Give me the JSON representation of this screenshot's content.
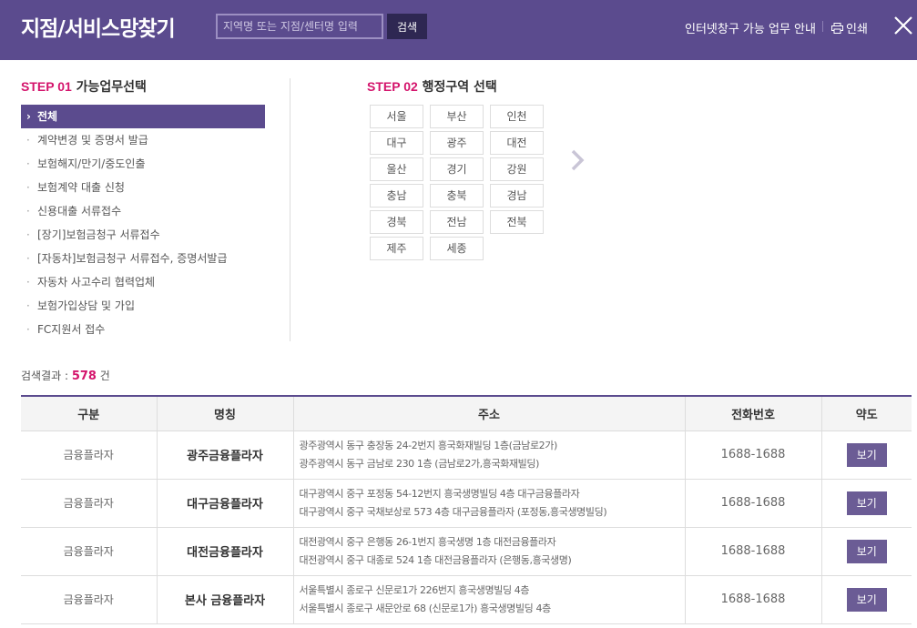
{
  "header": {
    "title": "지점/서비스망찾기",
    "search_placeholder": "지역명 또는 지점/센터명 입력",
    "search_button": "검색",
    "guide_link": "인터넷창구 가능 업무 안내",
    "print_label": "인쇄",
    "icons": {
      "print": "printer-icon",
      "close": "close-icon"
    }
  },
  "step1": {
    "step_label": "STEP 01",
    "title": "가능업무선택",
    "items": [
      {
        "mark": "›",
        "label": "전체",
        "active": true
      },
      {
        "mark": "·",
        "label": "계약변경 및 증명서 발급"
      },
      {
        "mark": "·",
        "label": "보험해지/만기/중도인출"
      },
      {
        "mark": "·",
        "label": "보험계약 대출 신청"
      },
      {
        "mark": "·",
        "label": "신용대출 서류접수"
      },
      {
        "mark": "·",
        "label": "[장기]보험금청구 서류접수"
      },
      {
        "mark": "·",
        "label": "[자동차]보험금청구 서류접수, 증명서발급"
      },
      {
        "mark": "·",
        "label": "자동차 사고수리 협력업체"
      },
      {
        "mark": "·",
        "label": "보험가입상담 및 가입"
      },
      {
        "mark": "·",
        "label": "FC지원서 접수"
      }
    ]
  },
  "step2": {
    "step_label": "STEP 02",
    "title": "행정구역 선택",
    "regions": [
      "서울",
      "부산",
      "인천",
      "대구",
      "광주",
      "대전",
      "울산",
      "경기",
      "강원",
      "충남",
      "충북",
      "경남",
      "경북",
      "전남",
      "전북",
      "제주",
      "세종"
    ],
    "next_icon": "chevron-right-icon"
  },
  "results": {
    "label": "검색결과 : ",
    "count": "578",
    "unit": " 건",
    "columns": [
      "구분",
      "명칭",
      "주소",
      "전화번호",
      "약도"
    ],
    "rows": [
      {
        "type": "금융플라자",
        "name": "광주금융플라자",
        "addr1": "광주광역시 동구 충장동 24-2번지 흥국화재빌딩 1층(금남로2가)",
        "addr2": "광주광역시 동구 금남로 230 1층 (금남로2가,흥국화재빌딩)",
        "phone": "1688-1688",
        "map": "보기"
      },
      {
        "type": "금융플라자",
        "name": "대구금융플라자",
        "addr1": "대구광역시 중구 포정동 54-12번지 흥국생명빌딩 4층 대구금융플라자",
        "addr2": "대구광역시 중구 국채보상로 573 4층 대구금융플라자 (포정동,흥국생명빌딩)",
        "phone": "1688-1688",
        "map": "보기"
      },
      {
        "type": "금융플라자",
        "name": "대전금융플라자",
        "addr1": "대전광역시 중구 은행동 26-1번지 흥국생명 1층 대전금융플라자",
        "addr2": "대전광역시 중구 대종로 524 1층 대전금융플라자 (은행동,흥국생명)",
        "phone": "1688-1688",
        "map": "보기"
      },
      {
        "type": "금융플라자",
        "name": "본사 금융플라자",
        "addr1": "서울특별시 종로구 신문로1가 226번지 흥국생명빌딩 4층",
        "addr2": "서울특별시 종로구 새문안로 68 (신문로1가) 흥국생명빌딩 4층",
        "phone": "1688-1688",
        "map": "보기"
      }
    ]
  },
  "colors": {
    "brand_purple": "#5b4b8e",
    "accent_pink": "#d4146c",
    "button_purple": "#6b5c95"
  }
}
